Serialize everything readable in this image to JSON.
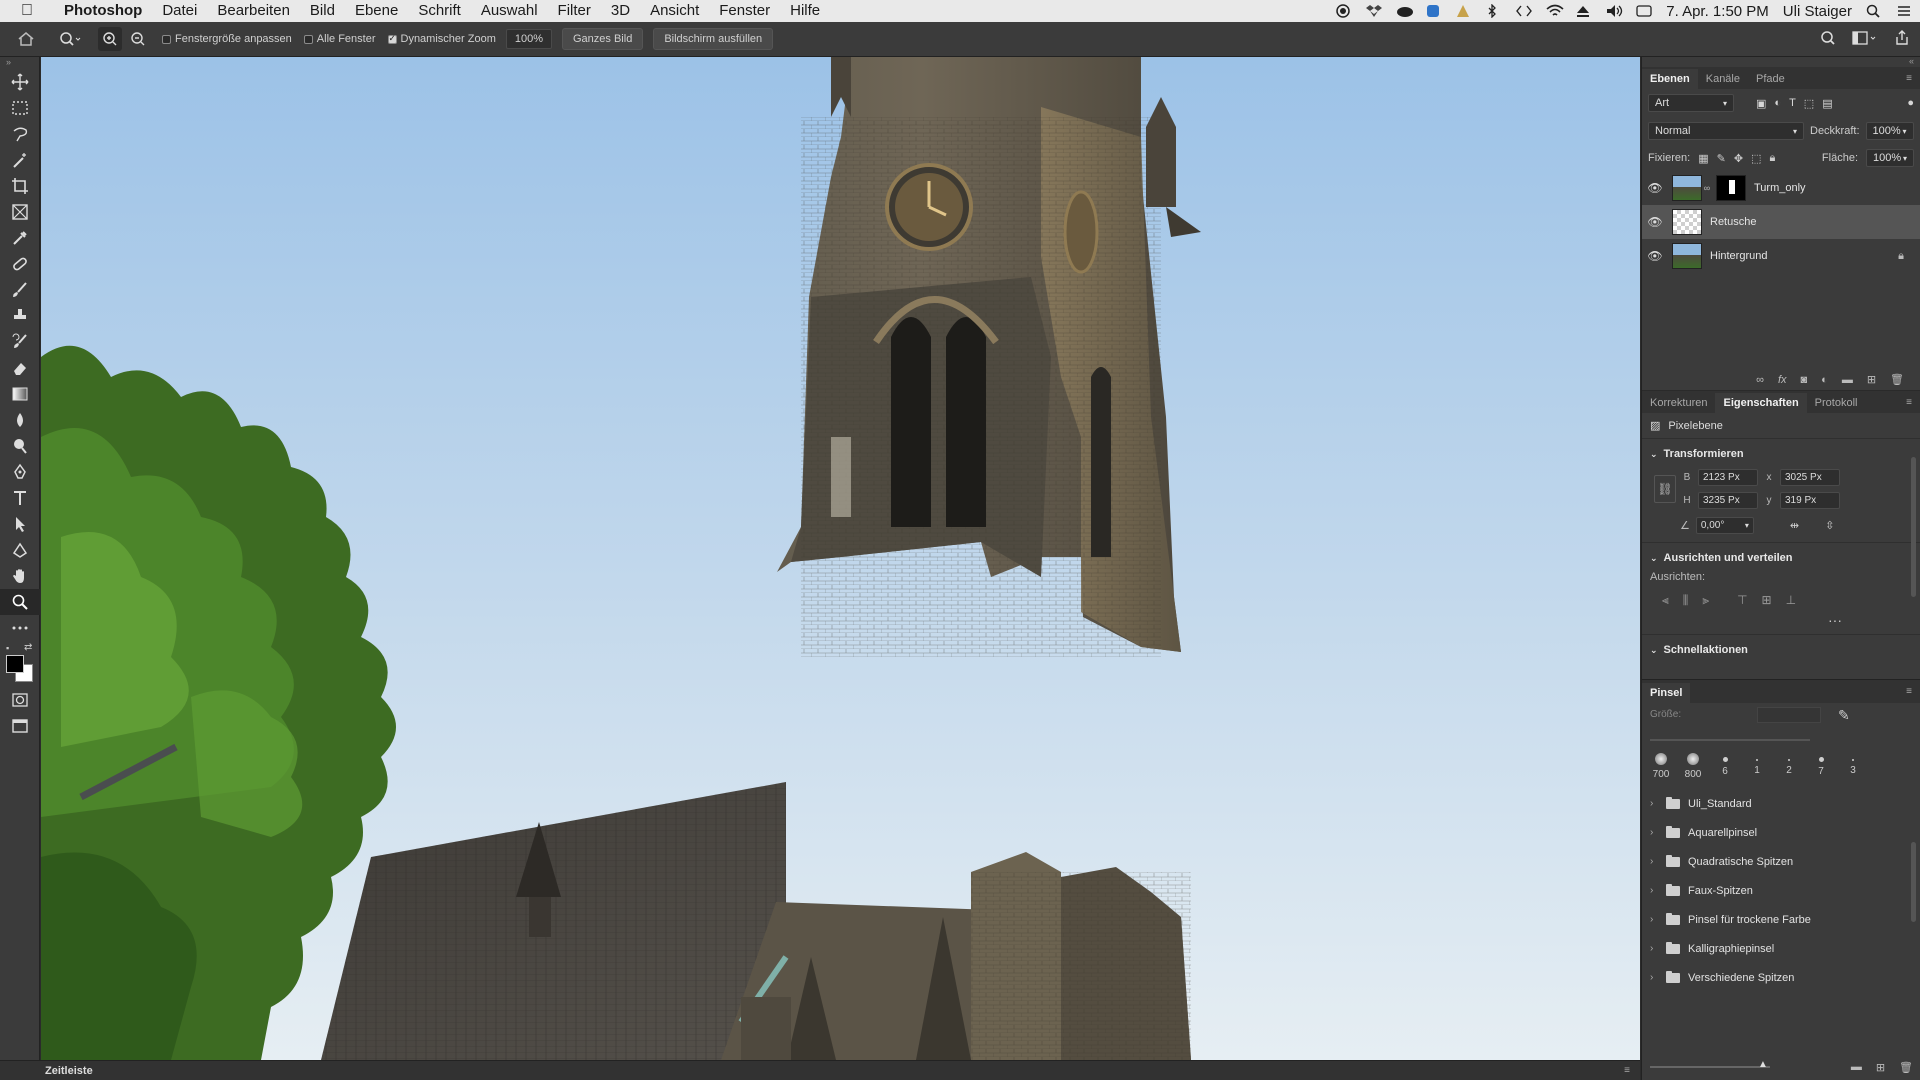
{
  "menubar": {
    "app_name": "Photoshop",
    "items": [
      "Datei",
      "Bearbeiten",
      "Bild",
      "Ebene",
      "Schrift",
      "Auswahl",
      "Filter",
      "3D",
      "Ansicht",
      "Fenster",
      "Hilfe"
    ],
    "clock": "7. Apr.  1:50 PM",
    "user": "Uli Staiger"
  },
  "options_bar": {
    "resize_windows_label": "Fenstergröße anpassen",
    "resize_windows_checked": false,
    "all_windows_label": "Alle Fenster",
    "all_windows_checked": false,
    "scrubby_zoom_label": "Dynamischer Zoom",
    "scrubby_zoom_checked": true,
    "zoom_value": "100%",
    "fit_screen_label": "Ganzes Bild",
    "fill_screen_label": "Bildschirm ausfüllen"
  },
  "timeline": {
    "label": "Zeitleiste"
  },
  "layers_panel": {
    "tabs": [
      "Ebenen",
      "Kanäle",
      "Pfade"
    ],
    "active_tab": "Ebenen",
    "filter_kind": "Art",
    "blend_mode": "Normal",
    "opacity_label": "Deckkraft:",
    "opacity_value": "100%",
    "lock_label": "Fixieren:",
    "fill_label": "Fläche:",
    "fill_value": "100%",
    "layers": [
      {
        "name": "Turm_only",
        "visible": true,
        "has_mask": true,
        "selected": false,
        "locked": false
      },
      {
        "name": "Retusche",
        "visible": true,
        "has_mask": false,
        "selected": true,
        "locked": false
      },
      {
        "name": "Hintergrund",
        "visible": true,
        "has_mask": false,
        "selected": false,
        "locked": true
      }
    ]
  },
  "properties_panel": {
    "tabs": [
      "Korrekturen",
      "Eigenschaften",
      "Protokoll"
    ],
    "active_tab": "Eigenschaften",
    "layer_type": "Pixelebene",
    "transform": {
      "title": "Transformieren",
      "w_label": "B",
      "w": "2123 Px",
      "h_label": "H",
      "h": "3235 Px",
      "x_label": "x",
      "x": "3025 Px",
      "y_label": "y",
      "y": "319 Px",
      "angle": "0,00°"
    },
    "align": {
      "title": "Ausrichten und verteilen",
      "label": "Ausrichten:"
    },
    "quick_actions": {
      "title": "Schnellaktionen"
    }
  },
  "brush_panel": {
    "title": "Pinsel",
    "size_label": "Größe:",
    "presets": [
      "700",
      "800",
      "6",
      "1",
      "2",
      "7",
      "3"
    ],
    "folders": [
      "Uli_Standard",
      "Aquarellpinsel",
      "Quadratische Spitzen",
      "Faux-Spitzen",
      "Pinsel für trockene Farbe",
      "Kalligraphiepinsel",
      "Verschiedene Spitzen"
    ]
  },
  "colors": {
    "foreground": "#000000",
    "background": "#ffffff",
    "sky_top": "#9fc4e8",
    "sky_bottom": "#e4eef4"
  }
}
